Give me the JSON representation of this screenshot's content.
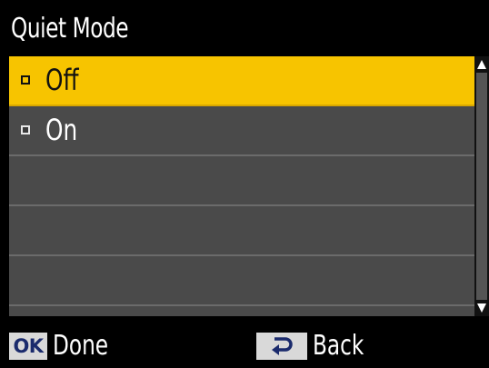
{
  "title": "Quiet Mode",
  "options": [
    {
      "label": "Off",
      "selected": true
    },
    {
      "label": "On",
      "selected": false
    }
  ],
  "footer": {
    "ok_key": "OK",
    "ok_label": "Done",
    "back_label": "Back"
  },
  "colors": {
    "selection": "#f7c400",
    "list_background": "#4a4a4a",
    "screen_background": "#000000"
  }
}
